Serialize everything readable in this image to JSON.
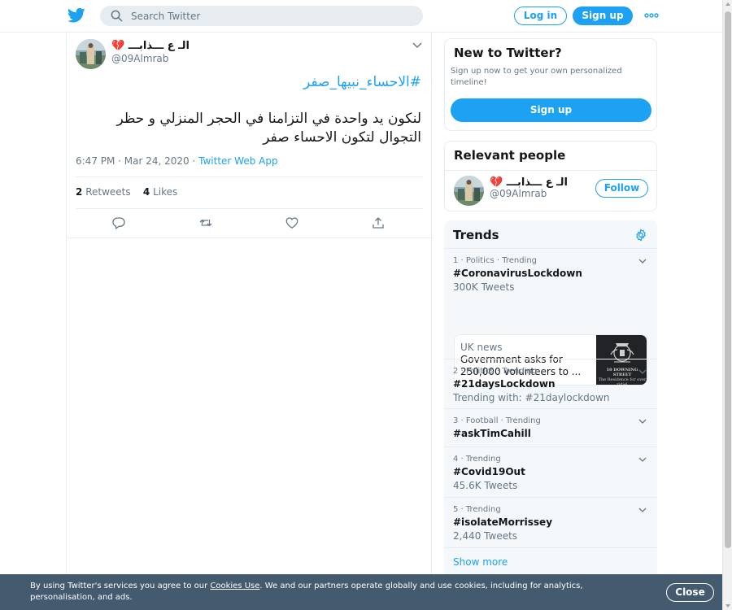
{
  "header": {
    "search_placeholder": "Search Twitter",
    "login_label": "Log in",
    "signup_label": "Sign up",
    "more_icon": "more-dots-icon",
    "brand_color": "#1da1f2"
  },
  "tweet": {
    "author_name": "الـ ع ـــذابـــ",
    "author_emoji": "💔",
    "author_handle": "@09Almrab",
    "hashtag": "#الاحساء_نبيها_صفر",
    "text": "لنكون يد واحدة في التزامنا في الحجر المنزلي و حظر التجوال لتكون الاحساء صفر",
    "time": "6:47 PM · Mar 24, 2020 · ",
    "via": "Twitter Web App",
    "retweets_count": "2",
    "retweets_label": "Retweets",
    "likes_count": "4",
    "likes_label": "Likes",
    "actions": [
      "reply-icon",
      "retweet-icon",
      "like-icon",
      "share-icon"
    ]
  },
  "new_to_twitter": {
    "title": "New to Twitter?",
    "subtitle": "Sign up now to get your own personalized timeline!",
    "signup_label": "Sign up"
  },
  "relevant_people": {
    "title": "Relevant people",
    "person_name": "الـ ع ـــذابـــ",
    "person_emoji": "💔",
    "person_handle": "@09Almrab",
    "follow_label": "Follow"
  },
  "trends": {
    "title": "Trends",
    "items": [
      {
        "context": "1 · Politics · Trending",
        "name": "#CoronavirusLockdown",
        "count": "300K Tweets"
      },
      {
        "context": "2 · Politics · Trending",
        "name": "#21daysLockdown",
        "count": "Trending with: #21daylockdown"
      },
      {
        "context": "3 · Football · Trending",
        "name": "#askTimCahill",
        "count": ""
      },
      {
        "context": "4 · Trending",
        "name": "#Covid19Out",
        "count": "45.6K Tweets"
      },
      {
        "context": "5 · Trending",
        "name": "#isolateMorrissey",
        "count": "2,440 Tweets"
      }
    ],
    "news": {
      "source": "UK news",
      "headline": "Government asks for 250,000 volunteers to ...",
      "thumb_title": "10 DOWNING STREET",
      "thumb_sub": "The Residence for over ridiel"
    },
    "show_more": "Show more"
  },
  "cookie": {
    "text_before": "By using Twitter's services you agree to our ",
    "link": "Cookies Use",
    "text_after": ". We and our partners operate globally and use cookies, including for analytics, personalisation, and ads.",
    "close_label": "Close",
    "background": "#435a6f"
  }
}
